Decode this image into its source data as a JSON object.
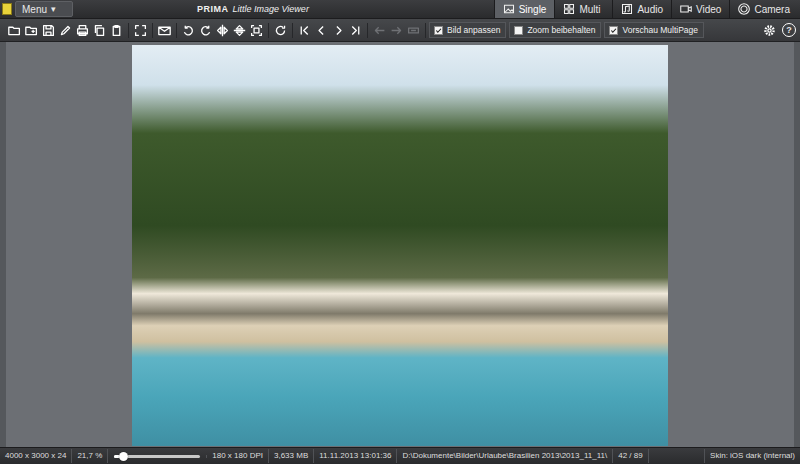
{
  "window": {
    "brand": "PRIMA",
    "title": "Little Image Viewer"
  },
  "menu": {
    "label": "Menu",
    "arrow": "▾"
  },
  "tabs": [
    {
      "label": "Single",
      "selected": true
    },
    {
      "label": "Multi",
      "selected": false
    },
    {
      "label": "Audio",
      "selected": false
    },
    {
      "label": "Video",
      "selected": false
    },
    {
      "label": "Camera",
      "selected": false
    }
  ],
  "toolbar": {
    "buttons": [
      {
        "disabled": false
      },
      {
        "disabled": false
      },
      {
        "disabled": false
      },
      {
        "disabled": false
      },
      {
        "disabled": false
      },
      {
        "disabled": false
      },
      {
        "disabled": false
      },
      {
        "disabled": false
      },
      {
        "disabled": false
      },
      {
        "disabled": false
      },
      {
        "disabled": false
      },
      {
        "disabled": false
      },
      {
        "disabled": false
      },
      {
        "disabled": false
      },
      {
        "disabled": false
      },
      {
        "disabled": false
      },
      {
        "disabled": false
      },
      {
        "disabled": false
      },
      {
        "disabled": false
      },
      {
        "disabled": true
      },
      {
        "disabled": true
      },
      {
        "disabled": true
      }
    ],
    "checkboxes": [
      {
        "label": "Bild anpassen",
        "checked": true
      },
      {
        "label": "Zoom beibehalten",
        "checked": false
      },
      {
        "label": "Vorschau MultiPage",
        "checked": true
      }
    ],
    "help": "?"
  },
  "status_bar": {
    "dimensions": "4000 x 3000 x 24",
    "zoom": "21,7 %",
    "zoom_slider": {
      "level": 0.1
    },
    "dpi": "180 x 180 DPI",
    "size": "3,633 MB",
    "date": "11.11.2013 13:01:36",
    "path": "D:\\Dokumente\\Bilder\\Urlaube\\Brasilien 2013\\2013_11_11\\",
    "position": "42 / 89",
    "skin": "Skin: iOS dark (internal)"
  }
}
